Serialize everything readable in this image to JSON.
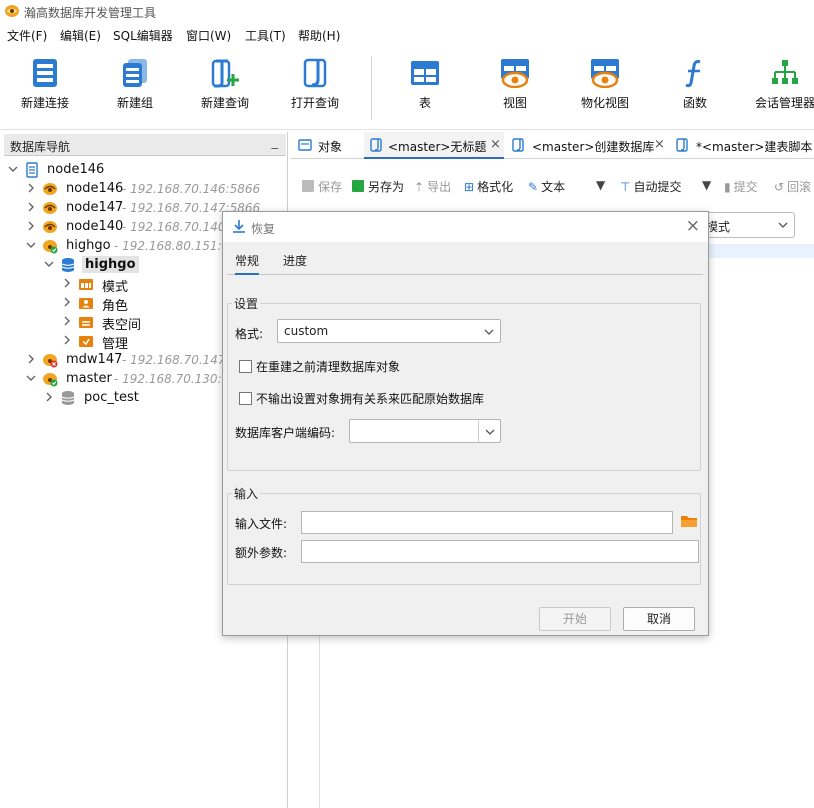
{
  "app": {
    "title": "瀚高数据库开发管理工具"
  },
  "menu": [
    "文件(F)",
    "编辑(E)",
    "SQL编辑器",
    "窗口(W)",
    "工具(T)",
    "帮助(H)"
  ],
  "toolbar": {
    "new_connection": "新建连接",
    "new_group": "新建组",
    "new_query": "新建查询",
    "open_query": "打开查询",
    "table": "表",
    "view": "视图",
    "materialized_view": "物化视图",
    "function": "函数",
    "session_manager": "会话管理器"
  },
  "nav": {
    "title": "数据库导航",
    "minimize": "_",
    "tree": [
      {
        "label": "node146",
        "ip": ""
      },
      {
        "label": "node146",
        "ip": "- 192.168.70.146:5866"
      },
      {
        "label": "node147",
        "ip": "- 192.168.70.147:5866"
      },
      {
        "label": "node140",
        "ip": "- 192.168.70.140:5866"
      },
      {
        "label": "highgo",
        "ip": "- 192.168.80.151:5866"
      },
      {
        "label": "highgo",
        "ip": ""
      },
      {
        "label": "模式",
        "ip": ""
      },
      {
        "label": "角色",
        "ip": ""
      },
      {
        "label": "表空间",
        "ip": ""
      },
      {
        "label": "管理",
        "ip": ""
      },
      {
        "label": "mdw147",
        "ip": "- 192.168.70.147:5866"
      },
      {
        "label": "master",
        "ip": "- 192.168.70.130:5866"
      },
      {
        "label": "poc_test",
        "ip": ""
      }
    ]
  },
  "editor_tabs": [
    "对象",
    "<master>无标题",
    "<master>创建数据库",
    "*<master>建表脚本"
  ],
  "editor_toolbar": {
    "save": "保存",
    "save_as": "另存为",
    "export": "导出",
    "format": "格式化",
    "text": "文本",
    "auto_commit": "自动提交",
    "commit": "提交",
    "rollback": "回滚"
  },
  "editor_select": {
    "value": "模式"
  },
  "dialog": {
    "title": "恢复",
    "close": "×",
    "tabs": [
      "常规",
      "进度"
    ],
    "settings_legend": "设置",
    "format_label": "格式:",
    "format_value": "custom",
    "clean_label": "在重建之前清理数据库对象",
    "no_owner_label": "不输出设置对象拥有关系来匹配原始数据库",
    "encoding_label": "数据库客户端编码:",
    "encoding_value": "",
    "input_legend": "输入",
    "input_file_label": "输入文件:",
    "input_file_value": "",
    "extra_params_label": "额外参数:",
    "extra_params_value": "",
    "start_button": "开始",
    "cancel_button": "取消"
  },
  "colors": {
    "accent": "#2b6fc2",
    "folder_orange": "#e8820e",
    "disabled_text": "#999999"
  }
}
